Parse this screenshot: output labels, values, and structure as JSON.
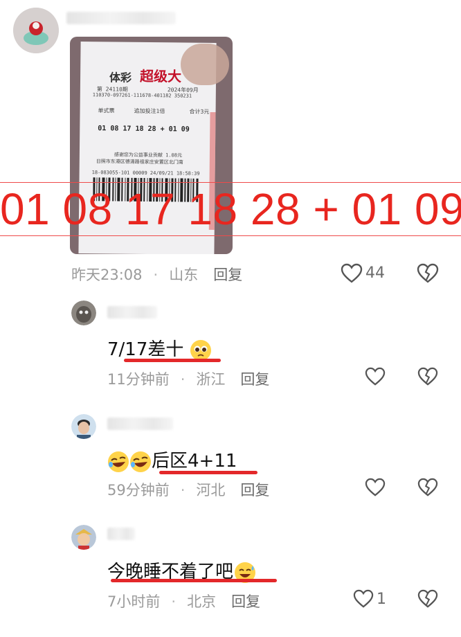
{
  "top_comment": {
    "image": {
      "ticket_brand_1": "体彩",
      "ticket_brand_2": "超级大",
      "ticket_issue": "第 24110期",
      "ticket_date": "2024年09月",
      "ticket_serial": "110370-097261-111678-401182 350231",
      "ticket_type": "单式票",
      "ticket_addon": "追加投注1倍",
      "ticket_total": "合计3元",
      "ticket_numbers": "01  08  17  18  28    +    01  09",
      "ticket_charity": "感谢您为公益事业贡献 1.08元",
      "ticket_address": "日照市东港区德清路祖家庄安置区北门南",
      "ticket_footer": "18-083055-101    00009    24/09/21 18:58:39"
    },
    "overlay_numbers": "01 08 17 18 28 + 01 09",
    "time": "昨天23:08",
    "location": "山东",
    "reply_label": "回复",
    "like_count": "44"
  },
  "replies": [
    {
      "text": "7/17差十",
      "emoji": "pleading-face",
      "time": "11分钟前",
      "location": "浙江",
      "reply_label": "回复",
      "like_count": ""
    },
    {
      "text": "后区4+11",
      "emoji": "rofl-face",
      "time": "59分钟前",
      "location": "河北",
      "reply_label": "回复",
      "like_count": ""
    },
    {
      "text": "今晚睡不着了吧",
      "emoji": "sweat-smile-face",
      "time": "7小时前",
      "location": "北京",
      "reply_label": "回复",
      "like_count": "1"
    }
  ],
  "colors": {
    "accent_red": "#e3282a",
    "meta_gray": "#9a9a9a",
    "icon_gray": "#6b6b6b"
  }
}
